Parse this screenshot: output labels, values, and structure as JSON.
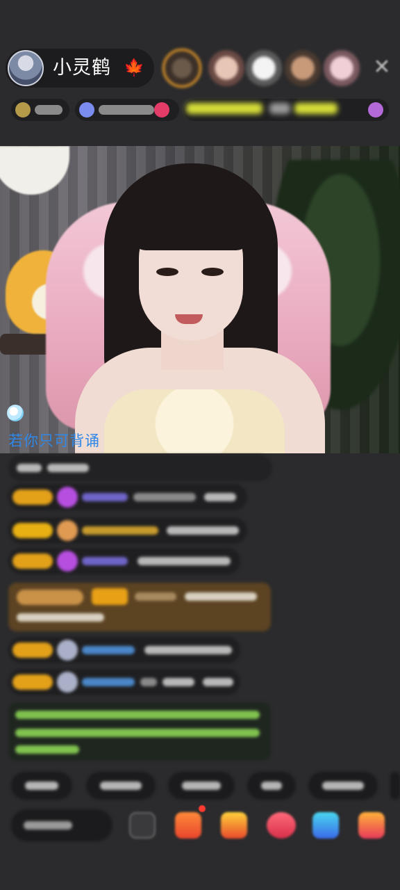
{
  "header": {
    "host_name": "小灵鹤",
    "host_badge": "🍁",
    "close_icon": "✕"
  },
  "overlay": {
    "lyric": "若你只可背诵"
  },
  "colors": {
    "background": "#2b2b2d",
    "lyric": "#2f88e8",
    "level_badge": "#e3a11a",
    "gift_banner": "#5c4322",
    "notice_text": "#7fc24e"
  },
  "icons": [
    "maple-leaf-icon",
    "close-icon",
    "music-note-icon",
    "emoji-icon",
    "gift-icon"
  ]
}
